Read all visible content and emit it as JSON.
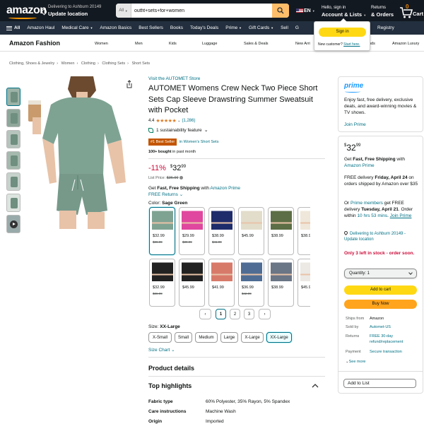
{
  "header": {
    "logo": "amazon",
    "deliver_line1": "Delivering to Ashburn 20149",
    "deliver_line2": "Update location",
    "search_category": "All",
    "search_value": "outfit+sets+for+women",
    "language": "EN",
    "account_line1": "Hello, sign in",
    "account_line2": "Account & Lists",
    "returns_line1": "Returns",
    "returns_line2": "& Orders",
    "cart_count": "0",
    "cart_label": "Cart"
  },
  "nav": {
    "all": "All",
    "items": [
      "Amazon Haul",
      "Medical Care",
      "Amazon Basics",
      "Best Sellers",
      "Books",
      "Today's Deals",
      "Prime",
      "Gift Cards",
      "Sell",
      "G"
    ],
    "registry": "Registry"
  },
  "signin_popover": {
    "button": "Sign in",
    "new_customer": "New customer?",
    "start_here": "Start here."
  },
  "fashion_bar": {
    "title": "Amazon Fashion",
    "items": [
      "Women",
      "Men",
      "Kids",
      "Luggage",
      "Sales & Deals",
      "New Arri",
      "nds",
      "Amazon Luxury"
    ]
  },
  "breadcrumb": [
    "Clothing, Shoes & Jewelry",
    "Women",
    "Clothing",
    "Clothing Sets",
    "Short Sets"
  ],
  "product": {
    "store_link": "Visit the AUTOMET Store",
    "title": "AUTOMET Womens Crew Neck Two Piece Short Sets Cap Sleeve Drawstring Summer Sweatsuit with Pocket",
    "rating": "4.4",
    "stars": "★★★★★",
    "reviews": "(1,286)",
    "sustainability": "1 sustainability feature",
    "best_seller_badge": "#1 Best Seller",
    "best_seller_category": "in Women's Short Sets",
    "bought_bold": "100+ bought",
    "bought_rest": " in past month",
    "discount": "-11%",
    "price_symbol": "$",
    "price_whole": "32",
    "price_fraction": "99",
    "list_price_label": "List Price: ",
    "list_price": "$36.99",
    "get_text": "Get ",
    "fast_free": "Fast, Free Shipping",
    "with_text": " with ",
    "amazon_prime": "Amazon Prime",
    "free_returns": "FREE Returns",
    "color_label": "Color: ",
    "color_value": "Sage Green",
    "size_label": "Size: ",
    "size_value": "XX-Large",
    "size_chart": "Size Chart",
    "product_details": "Product details",
    "top_highlights": "Top highlights"
  },
  "swatches": [
    {
      "price": "$32.99",
      "old": "$36.99",
      "color": "#7fa393",
      "selected": true
    },
    {
      "price": "$29.99",
      "old": "$39.99",
      "color": "#e0479e"
    },
    {
      "price": "$38.99",
      "old": "$41.99",
      "color": "#1f2c6b"
    },
    {
      "price": "$45.99",
      "old": "",
      "color": "#e2dccb"
    },
    {
      "price": "$38.99",
      "old": "",
      "color": "#5c6e45"
    },
    {
      "price": "$38.9",
      "old": "",
      "color": "#efe7da"
    },
    {
      "price": "$32.99",
      "old": "$36.99",
      "color": "#222222"
    },
    {
      "price": "$45.99",
      "old": "",
      "color": "#222222"
    },
    {
      "price": "$41.99",
      "old": "",
      "color": "#d87a6a"
    },
    {
      "price": "$36.99",
      "old": "$42.99",
      "color": "#4f6d94"
    },
    {
      "price": "$38.99",
      "old": "",
      "color": "#6a7585"
    },
    {
      "price": "$45.9",
      "old": "",
      "color": "#ece9e4"
    }
  ],
  "pages": [
    "1",
    "2",
    "3"
  ],
  "sizes": [
    "X-Small",
    "Small",
    "Medium",
    "Large",
    "X-Large",
    "XX-Large"
  ],
  "specs": [
    {
      "k": "Fabric type",
      "v": "60% Polyester, 35% Rayon, 5% Spandex"
    },
    {
      "k": "Care instructions",
      "v": "Machine Wash"
    },
    {
      "k": "Origin",
      "v": "Imported"
    }
  ],
  "prime_box": {
    "logo": "prime",
    "text": "Enjoy fast, free delivery, exclusive deals, and award-winning movies & TV shows.",
    "join": "Join Prime"
  },
  "buy_box": {
    "price_symbol": "$",
    "price_whole": "32",
    "price_fraction": "99",
    "get": "Get ",
    "fast_free": "Fast, Free Shipping",
    "with": " with",
    "amazon_prime": "Amazon Prime",
    "free_delivery": "FREE delivery ",
    "free_delivery_date": "Friday, April 24",
    "free_delivery_rest": " on orders shipped by Amazon over $35",
    "or": "Or ",
    "prime_members": "Prime members",
    "prime_rest": " get FREE delivery ",
    "prime_date": "Tuesday, April 21",
    "order_within": ". Order within ",
    "countdown": "10 hrs 53 mins",
    "join_prime": "Join Prime",
    "deliver_to": "Delivering to Ashburn 20149 - Update location",
    "stock": "Only 3 left in stock - order soon.",
    "quantity": "Quantity: 1",
    "add_to_cart": "Add to cart",
    "buy_now": "Buy Now",
    "details": [
      {
        "k": "Ships from",
        "v": "Amazon"
      },
      {
        "k": "Sold by",
        "v": "Automet-US"
      },
      {
        "k": "Returns",
        "v": "FREE 30-day refund/replacement"
      },
      {
        "k": "Payment",
        "v": "Secure transaction"
      }
    ],
    "see_more": "See more",
    "add_to_list": "Add to List"
  },
  "colors": {
    "topbar": "#131921",
    "navbar": "#232f3e",
    "accent": "#ff9900",
    "link": "#007185",
    "deal_red": "#cc0c39",
    "cart_yellow": "#ffd814",
    "buy_orange": "#ffa41c",
    "product_green": "#7fa393"
  }
}
